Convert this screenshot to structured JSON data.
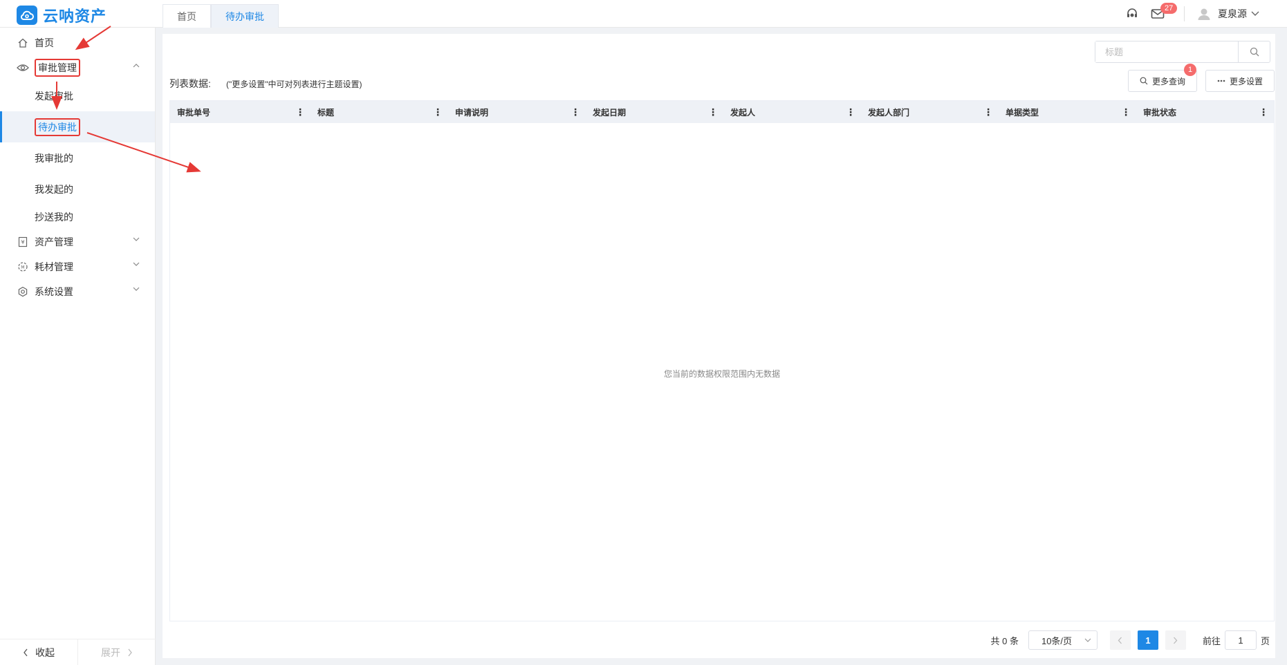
{
  "app": {
    "name": "云呐资产",
    "brand_color": "#1e88e5"
  },
  "header": {
    "tabs": [
      {
        "label": "首页"
      },
      {
        "label": "待办审批"
      }
    ],
    "message_count": "27",
    "user_name": "夏泉源"
  },
  "sidebar": {
    "home": "首页",
    "approval": "审批管理",
    "approval_items": [
      "发起审批",
      "待办审批",
      "我审批的",
      "我发起的",
      "抄送我的"
    ],
    "assets": "资产管理",
    "consumables": "耗材管理",
    "settings": "系统设置",
    "collapse": "收起",
    "expand": "展开"
  },
  "main": {
    "search_placeholder": "标题",
    "list_label": "列表数据:",
    "list_hint": "(\"更多设置\"中可对列表进行主题设置)",
    "more_query": "更多查询",
    "more_query_badge": "1",
    "more_settings": "更多设置",
    "columns": [
      "审批单号",
      "标题",
      "申请说明",
      "发起日期",
      "发起人",
      "发起人部门",
      "单据类型",
      "审批状态"
    ],
    "empty_text": "您当前的数据权限范围内无数据"
  },
  "pagination": {
    "total": "共 0 条",
    "page_size": "10条/页",
    "current_page": "1",
    "goto_label": "前往",
    "goto_value": "1",
    "page_unit": "页"
  },
  "annotation_color": "#e53935"
}
